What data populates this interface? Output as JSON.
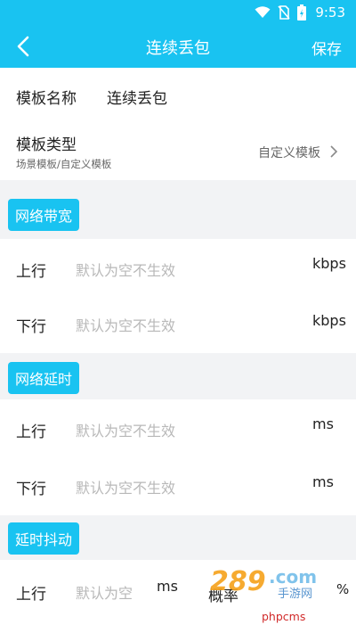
{
  "status": {
    "time": "9:53"
  },
  "appbar": {
    "title": "连续丢包",
    "save_label": "保存"
  },
  "template_name": {
    "label": "模板名称",
    "value": "连续丢包"
  },
  "template_type": {
    "label": "模板类型",
    "sub": "场景模板/自定义模板",
    "value": "自定义模板"
  },
  "sections": {
    "bandwidth": {
      "title": "网络带宽",
      "rows": [
        {
          "label": "上行",
          "placeholder": "默认为空不生效",
          "unit": "kbps"
        },
        {
          "label": "下行",
          "placeholder": "默认为空不生效",
          "unit": "kbps"
        }
      ]
    },
    "latency": {
      "title": "网络延时",
      "rows": [
        {
          "label": "上行",
          "placeholder": "默认为空不生效",
          "unit": "ms"
        },
        {
          "label": "下行",
          "placeholder": "默认为空不生效",
          "unit": "ms"
        }
      ]
    },
    "jitter": {
      "title": "延时抖动",
      "rows": [
        {
          "label": "上行",
          "placeholder": "默认为空",
          "unit": "ms",
          "prob_label": "概率",
          "prob_unit": "%"
        }
      ]
    }
  },
  "watermark": {
    "text": "phpcms"
  }
}
